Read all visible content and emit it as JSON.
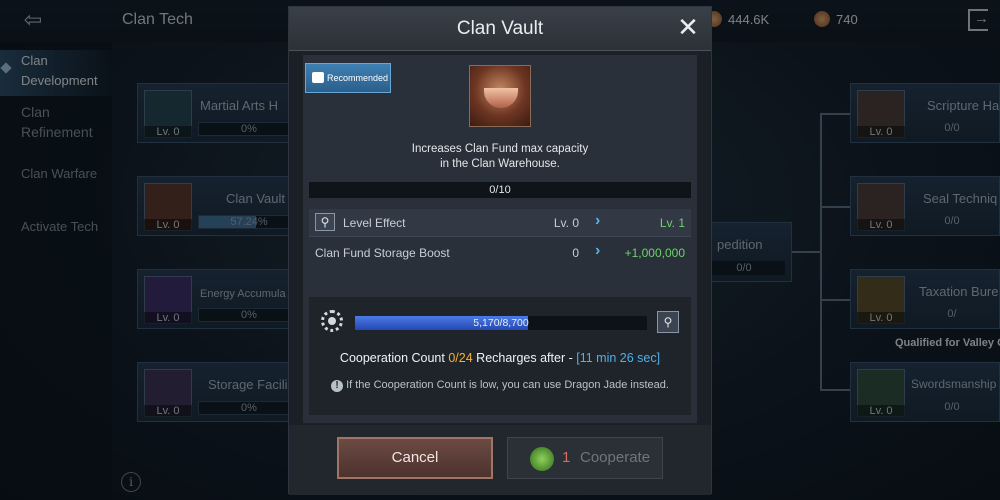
{
  "topbar": {
    "back_icon": "back-icon",
    "title": "Clan Tech",
    "currencies": [
      {
        "icon": "clan-fund-icon",
        "value": "444.6K"
      },
      {
        "icon": "coin-icon",
        "value": "740"
      }
    ],
    "exit_icon": "exit-icon"
  },
  "sidebar": {
    "items": [
      {
        "label": "Clan Development",
        "active": true
      },
      {
        "label": "Clan Refinement",
        "active": false
      },
      {
        "label": "Clan Warfare",
        "active": false
      },
      {
        "label": "Activate Tech",
        "active": false
      }
    ]
  },
  "left_cards": [
    {
      "name": "Martial Arts H",
      "level": "Lv. 0",
      "progress_text": "0%",
      "progress": 0
    },
    {
      "name": "Clan Vault",
      "level": "Lv. 0",
      "progress_text": "57.24%",
      "progress": 0.5724
    },
    {
      "name": "Energy Accumula",
      "level": "Lv. 0",
      "progress_text": "0%",
      "progress": 0
    },
    {
      "name": "Storage Facili",
      "level": "Lv. 0",
      "progress_text": "0%",
      "progress": 0
    }
  ],
  "middle_card": {
    "name": "pedition",
    "progress_text": "0/0"
  },
  "right_cards": [
    {
      "name": "Scripture Ha",
      "level": "Lv. 0",
      "progress_text": "0/0"
    },
    {
      "name": "Seal Techniq",
      "level": "Lv. 0",
      "progress_text": "0/0"
    },
    {
      "name": "Taxation Bure",
      "level": "Lv. 0",
      "progress_text": "0/"
    },
    {
      "name": "Swordsmanship",
      "level": "Lv. 0",
      "progress_text": "0/0"
    }
  ],
  "qualified_text": "Qualified for Valley C",
  "modal": {
    "title": "Clan Vault",
    "close_icon": "close-icon",
    "recommended_label": "Recommended",
    "description_line1": "Increases Clan Fund max capacity",
    "description_line2": "in the Clan Warehouse.",
    "level_progress": "0/10",
    "level_effect": {
      "label": "Level Effect",
      "current": "Lv. 0",
      "next": "Lv. 1"
    },
    "storage_boost": {
      "label": "Clan Fund Storage Boost",
      "current": "0",
      "next": "+1,000,000"
    },
    "cooperation": {
      "progress_text": "5,170/8,700",
      "progress": 0.594,
      "count_label": "Cooperation Count",
      "count_value": "0/24",
      "recharge_label": "Recharges after -",
      "recharge_time": "[11 min 26 sec]",
      "info_text": "If the Cooperation Count is low, you can use Dragon Jade instead."
    },
    "cancel_label": "Cancel",
    "cooperate_count": "1",
    "cooperate_label": "Cooperate"
  },
  "colors": {
    "accent_blue": "#4fb0e8",
    "accent_yellow": "#f2b233",
    "accent_green": "#6ed16e"
  }
}
